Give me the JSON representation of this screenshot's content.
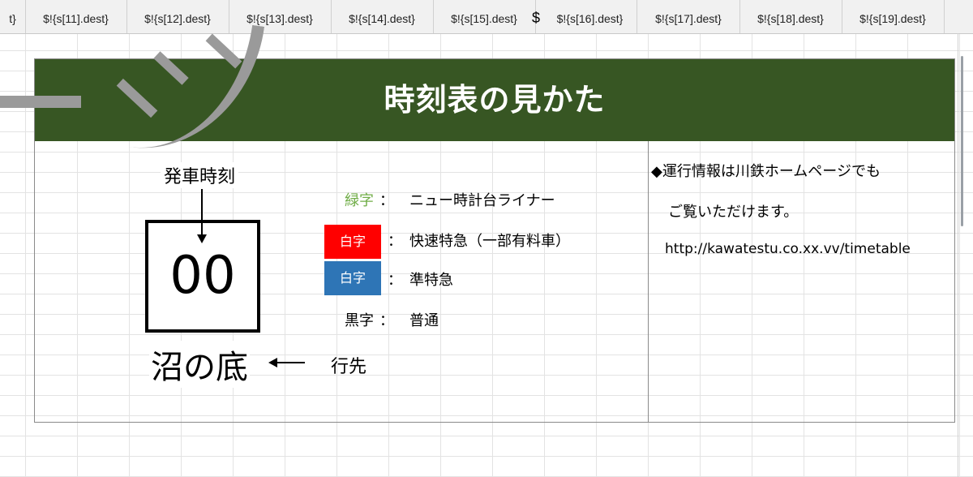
{
  "column_header": {
    "cells": [
      "t}",
      "$!{s[11].dest}",
      "$!{s[12].dest}",
      "$!{s[13].dest}",
      "$!{s[14].dest}",
      "$!{s[15].dest}",
      "$!{s[16].dest}",
      "$!{s[17].dest}",
      "$!{s[18].dest}",
      "$!{s[19].dest}"
    ],
    "dollar_sign": "$"
  },
  "title": "時刻表の見かた",
  "diagram": {
    "departure_label": "発車時刻",
    "sample_time": "00",
    "sample_destination": "沼の底",
    "destination_label": "行先"
  },
  "legend": {
    "colon": "：",
    "items": [
      {
        "key": "緑字",
        "description": "ニュー時計台ライナー",
        "color": "#70ad47"
      },
      {
        "key": "白字",
        "description": "快速特急（一部有料車）",
        "color": "#ff0000"
      },
      {
        "key": "白字",
        "description": "準特急",
        "color": "#2e75b6"
      },
      {
        "key": "黒字",
        "description": "普通",
        "color": "#000000"
      }
    ]
  },
  "info": {
    "line1": "◆運行情報は川鉄ホームページでも",
    "line2": "ご覧いただけます。",
    "url": "http://kawatestu.co.xx.vv/timetable"
  }
}
